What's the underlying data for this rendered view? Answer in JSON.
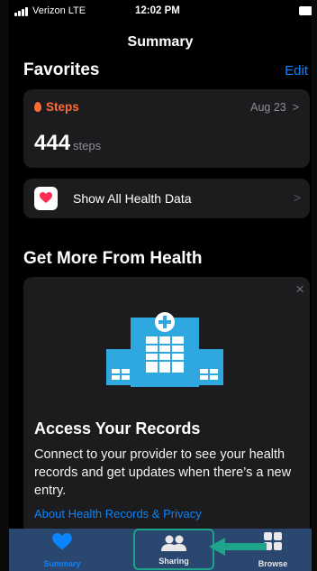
{
  "status_bar": {
    "carrier": "Verizon  LTE",
    "time": "12:02 PM"
  },
  "nav": {
    "title": "Summary"
  },
  "favorites": {
    "heading": "Favorites",
    "edit_label": "Edit",
    "steps": {
      "label": "Steps",
      "date": "Aug 23",
      "value": "444",
      "unit": "steps",
      "icon": "flame-icon"
    },
    "show_all": {
      "label": "Show All Health Data",
      "icon": "heart-icon"
    }
  },
  "get_more": {
    "heading": "Get More From Health",
    "card": {
      "title": "Access Your Records",
      "description": "Connect to your provider to see your health records and get updates when there’s a new entry.",
      "link": "About Health Records & Privacy",
      "icon": "hospital-icon"
    }
  },
  "tabbar": {
    "items": [
      {
        "label": "Summary",
        "icon": "heart-icon",
        "active": true
      },
      {
        "label": "Sharing",
        "icon": "people-icon",
        "active": false
      },
      {
        "label": "Browse",
        "icon": "grid-icon",
        "active": false
      }
    ]
  },
  "colors": {
    "accent": "#0a84ff",
    "steps": "#ff6b35",
    "highlight": "#1fa38a",
    "tabbar": "#2a4770"
  }
}
